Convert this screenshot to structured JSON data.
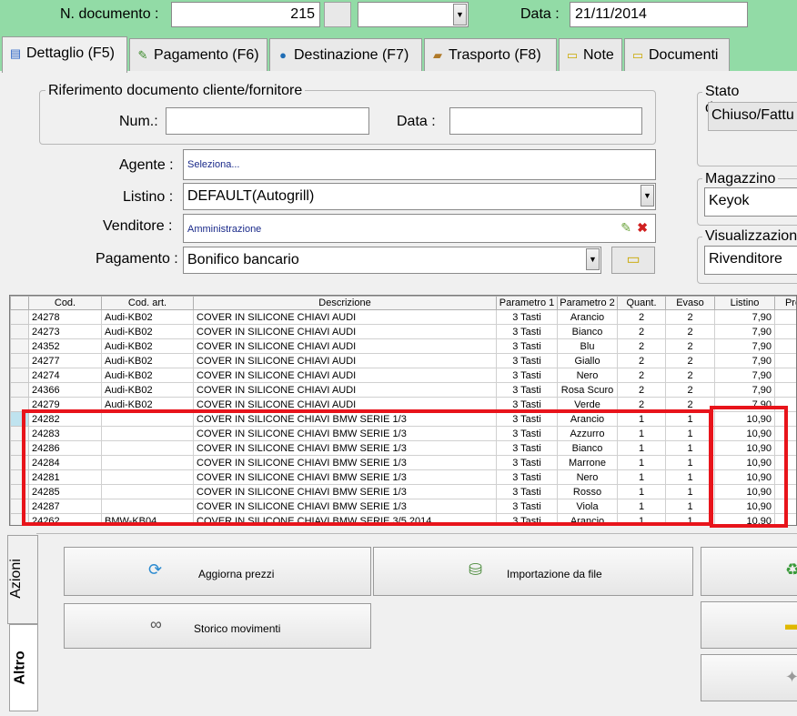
{
  "header": {
    "doc_label": "N. documento :",
    "doc_value": "215",
    "date_label": "Data :",
    "date_value": "21/11/2014"
  },
  "tabs": [
    {
      "label": "Dettaglio (F5)",
      "icon": "grid-icon",
      "active": true
    },
    {
      "label": "Pagamento (F6)",
      "icon": "money-icon"
    },
    {
      "label": "Destinazione (F7)",
      "icon": "globe-icon"
    },
    {
      "label": "Trasporto (F8)",
      "icon": "truck-icon"
    },
    {
      "label": "Note",
      "icon": "note-icon"
    },
    {
      "label": "Documenti",
      "icon": "folder-icon"
    }
  ],
  "rif": {
    "title": "Riferimento documento cliente/fornitore",
    "num_label": "Num.:",
    "num_value": "",
    "data_label": "Data :",
    "data_value": ""
  },
  "form": {
    "agente_label": "Agente :",
    "agente_value": "Seleziona...",
    "listino_label": "Listino :",
    "listino_value": "DEFAULT(Autogrill)",
    "venditore_label": "Venditore :",
    "venditore_value": "Amministrazione",
    "pagamento_label": "Pagamento :",
    "pagamento_value": "Bonifico bancario"
  },
  "side": {
    "stato_title": "Stato docume",
    "stato_value": "Chiuso/Fattu",
    "magazzino_title": "Magazzino",
    "magazzino_value": "Keyok",
    "visual_title": "Visualizzazion",
    "visual_value": "Rivenditore"
  },
  "grid": {
    "columns": [
      "Cod.",
      "Cod. art.",
      "Descrizione",
      "Parametro 1",
      "Parametro 2",
      "Quant.",
      "Evaso",
      "Listino",
      "Pre"
    ],
    "rows": [
      [
        "24278",
        "Audi-KB02",
        "COVER IN SILICONE CHIAVI AUDI",
        "3 Tasti",
        "Arancio",
        "2",
        "2",
        "7,90"
      ],
      [
        "24273",
        "Audi-KB02",
        "COVER IN SILICONE CHIAVI AUDI",
        "3 Tasti",
        "Bianco",
        "2",
        "2",
        "7,90"
      ],
      [
        "24352",
        "Audi-KB02",
        "COVER IN SILICONE CHIAVI AUDI",
        "3 Tasti",
        "Blu",
        "2",
        "2",
        "7,90"
      ],
      [
        "24277",
        "Audi-KB02",
        "COVER IN SILICONE CHIAVI AUDI",
        "3 Tasti",
        "Giallo",
        "2",
        "2",
        "7,90"
      ],
      [
        "24274",
        "Audi-KB02",
        "COVER IN SILICONE CHIAVI AUDI",
        "3 Tasti",
        "Nero",
        "2",
        "2",
        "7,90"
      ],
      [
        "24366",
        "Audi-KB02",
        "COVER IN SILICONE CHIAVI AUDI",
        "3 Tasti",
        "Rosa Scuro",
        "2",
        "2",
        "7,90"
      ],
      [
        "24279",
        "Audi-KB02",
        "COVER IN SILICONE CHIAVI AUDI",
        "3 Tasti",
        "Verde",
        "2",
        "2",
        "7,90"
      ],
      [
        "24282",
        "",
        "COVER IN SILICONE CHIAVI BMW SERIE 1/3",
        "3 Tasti",
        "Arancio",
        "1",
        "1",
        "10,90"
      ],
      [
        "24283",
        "",
        "COVER IN SILICONE CHIAVI BMW SERIE 1/3",
        "3 Tasti",
        "Azzurro",
        "1",
        "1",
        "10,90"
      ],
      [
        "24286",
        "",
        "COVER IN SILICONE CHIAVI BMW SERIE 1/3",
        "3 Tasti",
        "Bianco",
        "1",
        "1",
        "10,90"
      ],
      [
        "24284",
        "",
        "COVER IN SILICONE CHIAVI BMW SERIE 1/3",
        "3 Tasti",
        "Marrone",
        "1",
        "1",
        "10,90"
      ],
      [
        "24281",
        "",
        "COVER IN SILICONE CHIAVI BMW SERIE 1/3",
        "3 Tasti",
        "Nero",
        "1",
        "1",
        "10,90"
      ],
      [
        "24285",
        "",
        "COVER IN SILICONE CHIAVI BMW SERIE 1/3",
        "3 Tasti",
        "Rosso",
        "1",
        "1",
        "10,90"
      ],
      [
        "24287",
        "",
        "COVER IN SILICONE CHIAVI BMW SERIE 1/3",
        "3 Tasti",
        "Viola",
        "1",
        "1",
        "10,90"
      ],
      [
        "24262",
        "BMW-KB04",
        "COVER IN SILICONE CHIAVI BMW SERIE 3/5 2014",
        "3 Tasti",
        "Arancio",
        "1",
        "1",
        "10,90"
      ]
    ],
    "selected_row": 7
  },
  "bottom": {
    "tab_azioni": "Azioni",
    "tab_altro": "Altro",
    "btn_aggiorna": "Aggiorna prezzi",
    "btn_import": "Importazione da file",
    "btn_storico": "Storico movimenti"
  },
  "colors": {
    "header_bg": "#92dba6",
    "highlight": "#e8141b"
  }
}
